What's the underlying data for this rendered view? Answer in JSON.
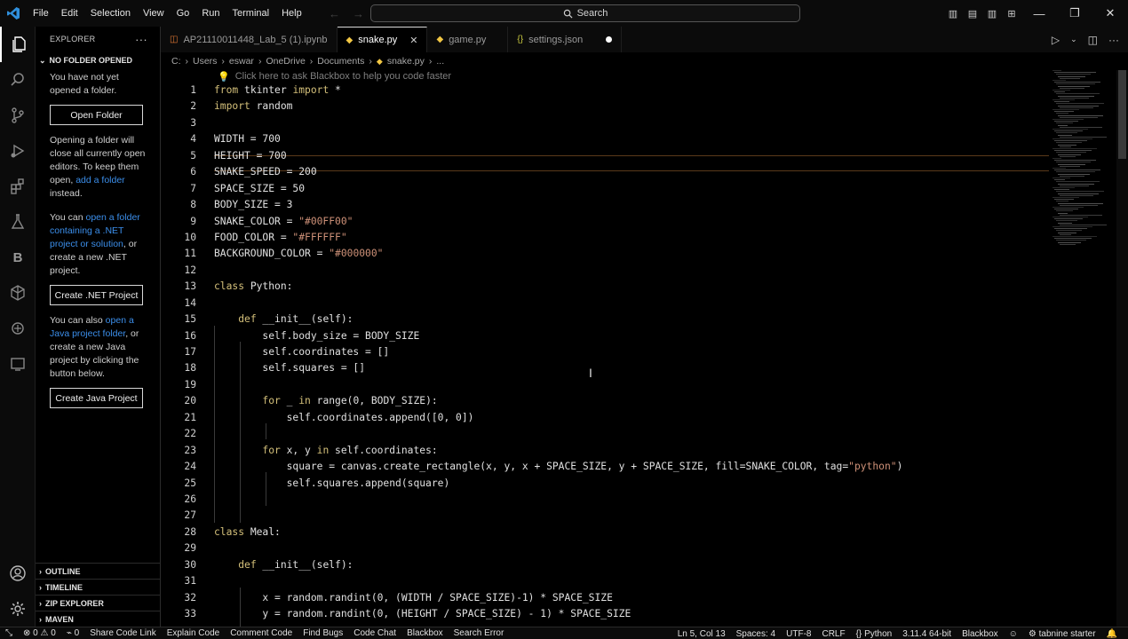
{
  "menu": [
    "File",
    "Edit",
    "Selection",
    "View",
    "Go",
    "Run",
    "Terminal",
    "Help"
  ],
  "search": {
    "label": "Search"
  },
  "explorer": {
    "title": "EXPLORER",
    "section": "NO FOLDER OPENED",
    "text1": "You have not yet opened a folder.",
    "open_folder": "Open Folder",
    "text2_a": "Opening a folder will close all currently open editors. To keep them open, ",
    "text2_link": "add a folder",
    "text2_b": " instead.",
    "text3_a": "You can ",
    "text3_link": "open a folder containing a .NET project or solution",
    "text3_b": ", or create a new .NET project.",
    "create_net": "Create .NET Project",
    "text4_a": "You can also ",
    "text4_link": "open a Java project folder",
    "text4_b": ", or create a new Java project by clicking the button below.",
    "create_java": "Create Java Project",
    "bottom_sections": [
      "OUTLINE",
      "TIMELINE",
      "ZIP EXPLORER",
      "MAVEN"
    ]
  },
  "tabs": [
    {
      "label": "AP21110011448_Lab_5 (1).ipynb"
    },
    {
      "label": "snake.py"
    },
    {
      "label": "game.py"
    },
    {
      "label": "settings.json"
    }
  ],
  "breadcrumb": [
    "C:",
    "Users",
    "eswar",
    "OneDrive",
    "Documents",
    "snake.py",
    "..."
  ],
  "hint": "Click here to ask Blackbox to help you code faster",
  "code": [
    {
      "n": "1",
      "t": "from tkinter import *"
    },
    {
      "n": "2",
      "t": "import random"
    },
    {
      "n": "3",
      "t": ""
    },
    {
      "n": "4",
      "t": "WIDTH = 700"
    },
    {
      "n": "5",
      "t": "HEIGHT = 700"
    },
    {
      "n": "6",
      "t": "SNAKE_SPEED = 200"
    },
    {
      "n": "7",
      "t": "SPACE_SIZE = 50"
    },
    {
      "n": "8",
      "t": "BODY_SIZE = 3"
    },
    {
      "n": "9",
      "t": "SNAKE_COLOR = \"#00FF00\""
    },
    {
      "n": "10",
      "t": "FOOD_COLOR = \"#FFFFFF\""
    },
    {
      "n": "11",
      "t": "BACKGROUND_COLOR = \"#000000\""
    },
    {
      "n": "12",
      "t": ""
    },
    {
      "n": "13",
      "t": "class Python:"
    },
    {
      "n": "14",
      "t": ""
    },
    {
      "n": "15",
      "t": "    def __init__(self):"
    },
    {
      "n": "16",
      "t": "        self.body_size = BODY_SIZE"
    },
    {
      "n": "17",
      "t": "        self.coordinates = []"
    },
    {
      "n": "18",
      "t": "        self.squares = []"
    },
    {
      "n": "19",
      "t": ""
    },
    {
      "n": "20",
      "t": "        for _ in range(0, BODY_SIZE):"
    },
    {
      "n": "21",
      "t": "            self.coordinates.append([0, 0])"
    },
    {
      "n": "22",
      "t": ""
    },
    {
      "n": "23",
      "t": "        for x, y in self.coordinates:"
    },
    {
      "n": "24",
      "t": "            square = canvas.create_rectangle(x, y, x + SPACE_SIZE, y + SPACE_SIZE, fill=SNAKE_COLOR, tag=\"python\")"
    },
    {
      "n": "25",
      "t": "            self.squares.append(square)"
    },
    {
      "n": "26",
      "t": ""
    },
    {
      "n": "27",
      "t": ""
    },
    {
      "n": "28",
      "t": "class Meal:"
    },
    {
      "n": "29",
      "t": ""
    },
    {
      "n": "30",
      "t": "    def __init__(self):"
    },
    {
      "n": "31",
      "t": ""
    },
    {
      "n": "32",
      "t": "        x = random.randint(0, (WIDTH / SPACE_SIZE)-1) * SPACE_SIZE"
    },
    {
      "n": "33",
      "t": "        y = random.randint(0, (HEIGHT / SPACE_SIZE) - 1) * SPACE_SIZE"
    }
  ],
  "status": {
    "left": [
      "0",
      "0",
      "0",
      "Share Code Link",
      "Explain Code",
      "Comment Code",
      "Find Bugs",
      "Code Chat",
      "Blackbox",
      "Search Error"
    ],
    "right": [
      "Ln 5, Col 13",
      "Spaces: 4",
      "UTF-8",
      "CRLF",
      "Python",
      "3.11.4 64-bit",
      "Blackbox",
      "tabnine starter"
    ]
  },
  "colors": {
    "keyword": "#d4c07a",
    "string": "#ce9178",
    "link": "#3b8eea"
  }
}
